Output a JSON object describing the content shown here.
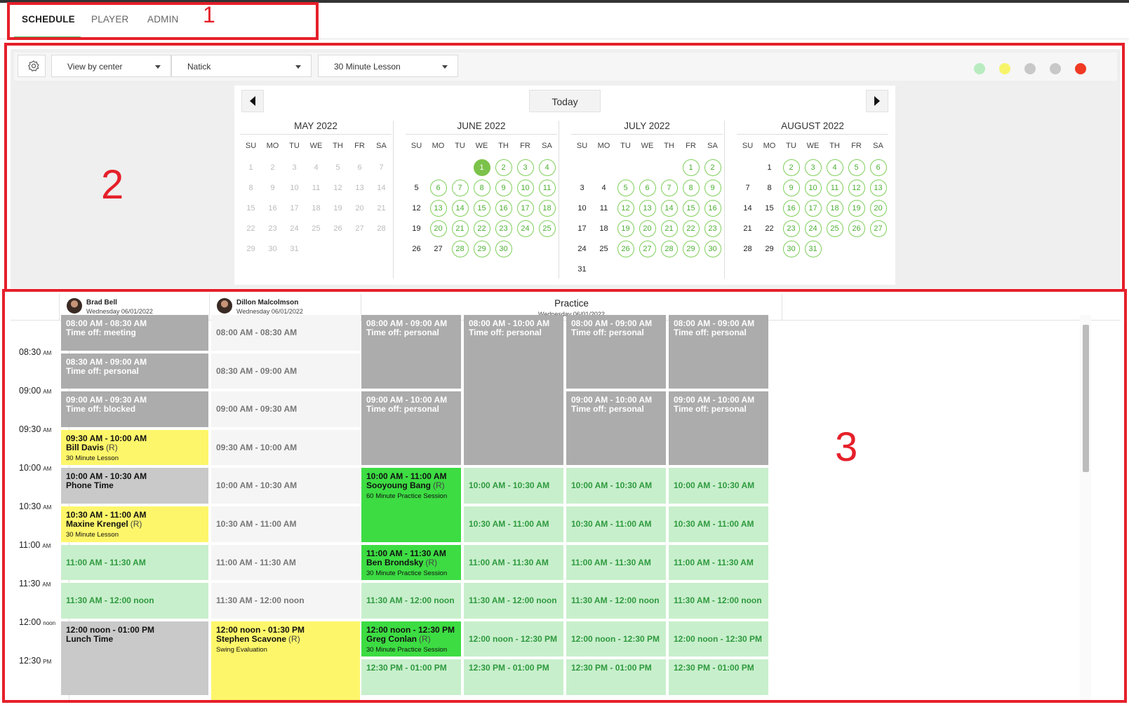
{
  "tabs": [
    {
      "label": "SCHEDULE",
      "active": true
    },
    {
      "label": "PLAYER",
      "active": false
    },
    {
      "label": "ADMIN",
      "active": false
    }
  ],
  "annotations": [
    "1",
    "2",
    "3"
  ],
  "toolbar": {
    "settings_icon": "gear-icon",
    "view_select": "View by center",
    "center_select": "Natick",
    "lesson_select": "30 Minute Lesson",
    "status_dots": [
      "#b8ecc0",
      "#f7f46a",
      "#c8c8c8",
      "#c8c8c8",
      "#f03a23"
    ]
  },
  "calendar": {
    "today_label": "Today",
    "prev_icon": "caret-left-icon",
    "next_icon": "caret-right-icon",
    "weekdays": [
      "SU",
      "MO",
      "TU",
      "WE",
      "TH",
      "FR",
      "SA"
    ],
    "months": [
      {
        "title": "MAY 2022",
        "offset": 0,
        "days": 31,
        "available": [],
        "selected": null,
        "enabled_plain": [],
        "past_all": true
      },
      {
        "title": "JUNE 2022",
        "offset": 3,
        "days": 30,
        "available": [
          2,
          3,
          4,
          6,
          7,
          8,
          9,
          10,
          11,
          13,
          14,
          15,
          16,
          17,
          18,
          20,
          21,
          22,
          23,
          24,
          25,
          28,
          29,
          30
        ],
        "selected": 1,
        "enabled_plain": [
          5,
          12,
          19,
          26,
          27
        ],
        "past_all": false
      },
      {
        "title": "JULY 2022",
        "offset": 5,
        "days": 31,
        "available": [
          1,
          2,
          5,
          6,
          7,
          8,
          9,
          12,
          13,
          14,
          15,
          16,
          19,
          20,
          21,
          22,
          23,
          26,
          27,
          28,
          29,
          30
        ],
        "selected": null,
        "enabled_plain": [
          3,
          4,
          10,
          11,
          17,
          18,
          24,
          25,
          31
        ],
        "past_all": false
      },
      {
        "title": "AUGUST 2022",
        "offset": 1,
        "days": 31,
        "available": [
          2,
          3,
          4,
          5,
          6,
          9,
          10,
          11,
          12,
          13,
          16,
          17,
          18,
          19,
          20,
          23,
          24,
          25,
          26,
          27,
          30,
          31
        ],
        "selected": null,
        "enabled_plain": [
          1,
          7,
          8,
          14,
          15,
          21,
          22,
          28,
          29
        ],
        "past_all": false
      }
    ]
  },
  "schedule": {
    "coaches": [
      {
        "name": "Brad Bell",
        "date": "Wednesday 06/01/2022"
      },
      {
        "name": "Dillon Malcolmson",
        "date": "Wednesday 06/01/2022"
      }
    ],
    "practice": {
      "title": "Practice",
      "date": "Wednesday 06/01/2022"
    },
    "time_labels": [
      {
        "time": "08:30",
        "suffix": "AM"
      },
      {
        "time": "09:00",
        "suffix": "AM"
      },
      {
        "time": "09:30",
        "suffix": "AM"
      },
      {
        "time": "10:00",
        "suffix": "AM"
      },
      {
        "time": "10:30",
        "suffix": "AM"
      },
      {
        "time": "11:00",
        "suffix": "AM"
      },
      {
        "time": "11:30",
        "suffix": "AM"
      },
      {
        "time": "12:00",
        "suffix": "noon"
      },
      {
        "time": "12:30",
        "suffix": "PM"
      }
    ],
    "columns": [
      {
        "slots": [
          {
            "start": 0,
            "len": 1,
            "style": "gray",
            "time": "08:00 AM - 08:30 AM",
            "name": "Time off: meeting"
          },
          {
            "start": 1,
            "len": 1,
            "style": "gray",
            "time": "08:30 AM - 09:00 AM",
            "name": "Time off: personal"
          },
          {
            "start": 2,
            "len": 1,
            "style": "gray",
            "time": "09:00 AM - 09:30 AM",
            "name": "Time off: blocked"
          },
          {
            "start": 3,
            "len": 1,
            "style": "yel",
            "time": "09:30 AM - 10:00 AM",
            "name": "Bill Davis",
            "tag": "(R)",
            "sub": "30 Minute Lesson"
          },
          {
            "start": 4,
            "len": 1,
            "style": "lgray",
            "time": "10:00 AM - 10:30 AM",
            "name": "Phone Time"
          },
          {
            "start": 5,
            "len": 1,
            "style": "yel",
            "time": "10:30 AM - 11:00 AM",
            "name": "Maxine Krengel",
            "tag": "(R)",
            "sub": "30 Minute Lesson"
          },
          {
            "start": 6,
            "len": 1,
            "style": "lgrn",
            "time": "11:00 AM - 11:30 AM",
            "center": true
          },
          {
            "start": 7,
            "len": 1,
            "style": "lgrn",
            "time": "11:30 AM - 12:00 noon",
            "center": true
          },
          {
            "start": 8,
            "len": 2,
            "style": "lgray",
            "time": "12:00 noon - 01:00 PM",
            "name": "Lunch Time"
          }
        ]
      },
      {
        "slots": [
          {
            "start": 0,
            "len": 1,
            "style": "off",
            "time": "08:00 AM - 08:30 AM",
            "center": true
          },
          {
            "start": 1,
            "len": 1,
            "style": "off",
            "time": "08:30 AM - 09:00 AM",
            "center": true
          },
          {
            "start": 2,
            "len": 1,
            "style": "off",
            "time": "09:00 AM - 09:30 AM",
            "center": true
          },
          {
            "start": 3,
            "len": 1,
            "style": "off",
            "time": "09:30 AM - 10:00 AM",
            "center": true
          },
          {
            "start": 4,
            "len": 1,
            "style": "off",
            "time": "10:00 AM - 10:30 AM",
            "center": true
          },
          {
            "start": 5,
            "len": 1,
            "style": "off",
            "time": "10:30 AM - 11:00 AM",
            "center": true
          },
          {
            "start": 6,
            "len": 1,
            "style": "off",
            "time": "11:00 AM - 11:30 AM",
            "center": true
          },
          {
            "start": 7,
            "len": 1,
            "style": "off",
            "time": "11:30 AM - 12:00 noon",
            "center": true
          },
          {
            "start": 8,
            "len": 3,
            "style": "yel",
            "time": "12:00 noon - 01:30 PM",
            "name": "Stephen Scavone",
            "tag": "(R)",
            "sub": "Swing Evaluation"
          }
        ]
      },
      {
        "slots": [
          {
            "start": 0,
            "len": 2,
            "style": "gray",
            "time": "08:00 AM - 09:00 AM",
            "name": "Time off: personal"
          },
          {
            "start": 2,
            "len": 2,
            "style": "gray",
            "time": "09:00 AM - 10:00 AM",
            "name": "Time off: personal"
          },
          {
            "start": 4,
            "len": 2,
            "style": "grn",
            "time": "10:00 AM - 11:00 AM",
            "name": "Sooyoung Bang",
            "tag": "(R)",
            "sub": "60 Minute Practice Session"
          },
          {
            "start": 6,
            "len": 1,
            "style": "grn",
            "time": "11:00 AM - 11:30 AM",
            "name": "Ben Brondsky",
            "tag": "(R)",
            "sub": "30 Minute Practice Session"
          },
          {
            "start": 7,
            "len": 1,
            "style": "lgrn",
            "time": "11:30 AM - 12:00 noon",
            "center": true
          },
          {
            "start": 8,
            "len": 1,
            "style": "grn",
            "time": "12:00 noon - 12:30 PM",
            "name": "Greg Conlan",
            "tag": "(R)",
            "sub": "30 Minute Practice Session"
          },
          {
            "start": 9,
            "len": 1,
            "style": "lgrn",
            "time": "12:30 PM - 01:00 PM"
          }
        ]
      },
      {
        "slots": [
          {
            "start": 0,
            "len": 4,
            "style": "gray",
            "time": "08:00 AM - 10:00 AM",
            "name": "Time off: personal"
          },
          {
            "start": 4,
            "len": 1,
            "style": "lgrn",
            "time": "10:00 AM - 10:30 AM",
            "center": true
          },
          {
            "start": 5,
            "len": 1,
            "style": "lgrn",
            "time": "10:30 AM - 11:00 AM",
            "center": true
          },
          {
            "start": 6,
            "len": 1,
            "style": "lgrn",
            "time": "11:00 AM - 11:30 AM",
            "center": true
          },
          {
            "start": 7,
            "len": 1,
            "style": "lgrn",
            "time": "11:30 AM - 12:00 noon",
            "center": true
          },
          {
            "start": 8,
            "len": 1,
            "style": "lgrn",
            "time": "12:00 noon - 12:30 PM",
            "center": true
          },
          {
            "start": 9,
            "len": 1,
            "style": "lgrn",
            "time": "12:30 PM - 01:00 PM"
          }
        ]
      },
      {
        "slots": [
          {
            "start": 0,
            "len": 2,
            "style": "gray",
            "time": "08:00 AM - 09:00 AM",
            "name": "Time off: personal"
          },
          {
            "start": 2,
            "len": 2,
            "style": "gray",
            "time": "09:00 AM - 10:00 AM",
            "name": "Time off: personal"
          },
          {
            "start": 4,
            "len": 1,
            "style": "lgrn",
            "time": "10:00 AM - 10:30 AM",
            "center": true
          },
          {
            "start": 5,
            "len": 1,
            "style": "lgrn",
            "time": "10:30 AM - 11:00 AM",
            "center": true
          },
          {
            "start": 6,
            "len": 1,
            "style": "lgrn",
            "time": "11:00 AM - 11:30 AM",
            "center": true
          },
          {
            "start": 7,
            "len": 1,
            "style": "lgrn",
            "time": "11:30 AM - 12:00 noon",
            "center": true
          },
          {
            "start": 8,
            "len": 1,
            "style": "lgrn",
            "time": "12:00 noon - 12:30 PM",
            "center": true
          },
          {
            "start": 9,
            "len": 1,
            "style": "lgrn",
            "time": "12:30 PM - 01:00 PM"
          }
        ]
      },
      {
        "slots": [
          {
            "start": 0,
            "len": 2,
            "style": "gray",
            "time": "08:00 AM - 09:00 AM",
            "name": "Time off: personal"
          },
          {
            "start": 2,
            "len": 2,
            "style": "gray",
            "time": "09:00 AM - 10:00 AM",
            "name": "Time off: personal"
          },
          {
            "start": 4,
            "len": 1,
            "style": "lgrn",
            "time": "10:00 AM - 10:30 AM",
            "center": true
          },
          {
            "start": 5,
            "len": 1,
            "style": "lgrn",
            "time": "10:30 AM - 11:00 AM",
            "center": true
          },
          {
            "start": 6,
            "len": 1,
            "style": "lgrn",
            "time": "11:00 AM - 11:30 AM",
            "center": true
          },
          {
            "start": 7,
            "len": 1,
            "style": "lgrn",
            "time": "11:30 AM - 12:00 noon",
            "center": true
          },
          {
            "start": 8,
            "len": 1,
            "style": "lgrn",
            "time": "12:00 noon - 12:30 PM",
            "center": true
          },
          {
            "start": 9,
            "len": 1,
            "style": "lgrn",
            "time": "12:30 PM - 01:00 PM"
          }
        ]
      }
    ]
  }
}
